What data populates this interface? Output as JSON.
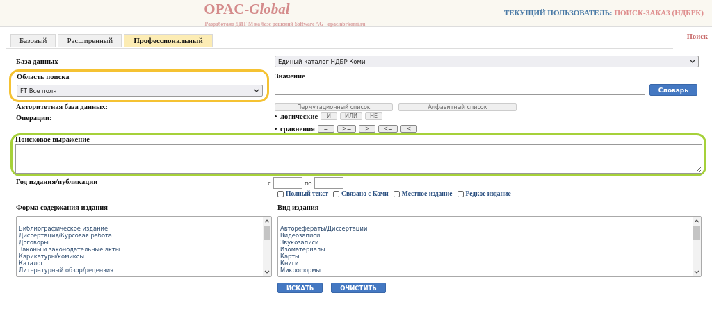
{
  "header": {
    "logo_plain": "OPAC-",
    "logo_italic": "Global",
    "subtitle": "Разработано ДИТ-М на базе решений Software AG - opac.nbrkomi.ru",
    "user_label": "ТЕКУЩИЙ ПОЛЬЗОВАТЕЛЬ:",
    "user_name": "ПОИСК-ЗАКАЗ (НДБРК)"
  },
  "tabs": [
    {
      "label": "Базовый",
      "selected": false
    },
    {
      "label": "Расширенный",
      "selected": false
    },
    {
      "label": "Профессиональный",
      "selected": true
    }
  ],
  "page_link": "Поиск",
  "database": {
    "label": "База данных",
    "value": "Единый каталог НДБР Коми"
  },
  "highlights": [
    {
      "color": "#f5c232"
    },
    {
      "color": "#a6d13a"
    }
  ],
  "search_area": {
    "label": "Область поиска",
    "value": "FT Все поля"
  },
  "value_field": {
    "label": "Значение",
    "button": "Словарь"
  },
  "authority": {
    "label": "Авторитетная база данных:",
    "buttons": [
      "Пермутационный список",
      "Алфавитный список"
    ]
  },
  "operations": {
    "label": "Операции:",
    "groups": [
      {
        "label": "логические",
        "buttons": [
          "И",
          "ИЛИ",
          "НЕ"
        ]
      },
      {
        "label": "сравнения",
        "buttons": [
          "=",
          ">=",
          ">",
          "<=",
          "<"
        ]
      }
    ]
  },
  "expression": {
    "label": "Поисковое выражение"
  },
  "year": {
    "label": "Год издания/публикации",
    "from_label": "с",
    "to_label": "по"
  },
  "filters": [
    {
      "label": "Полный текст",
      "checked": false
    },
    {
      "label": "Связано с Коми",
      "checked": false
    },
    {
      "label": "Местное издание",
      "checked": false
    },
    {
      "label": "Редкое издание",
      "checked": false
    }
  ],
  "content_form": {
    "label": "Форма содержания издания",
    "items": [
      "Библиографическое издание",
      "Диссертация/Курсовая работа",
      "Договоры",
      "Законы и законодательные акты",
      "Карикатуры/комиксы",
      "Каталог",
      "Литературный обзор/рецензия"
    ]
  },
  "publication_type": {
    "label": "Вид издания",
    "items": [
      "Авторефераты/Диссертации",
      "Видеозаписи",
      "Звукозаписи",
      "Изоматериалы",
      "Карты",
      "Книги",
      "Микроформы"
    ]
  },
  "actions": [
    "ИСКАТЬ",
    "ОЧИСТИТЬ"
  ]
}
